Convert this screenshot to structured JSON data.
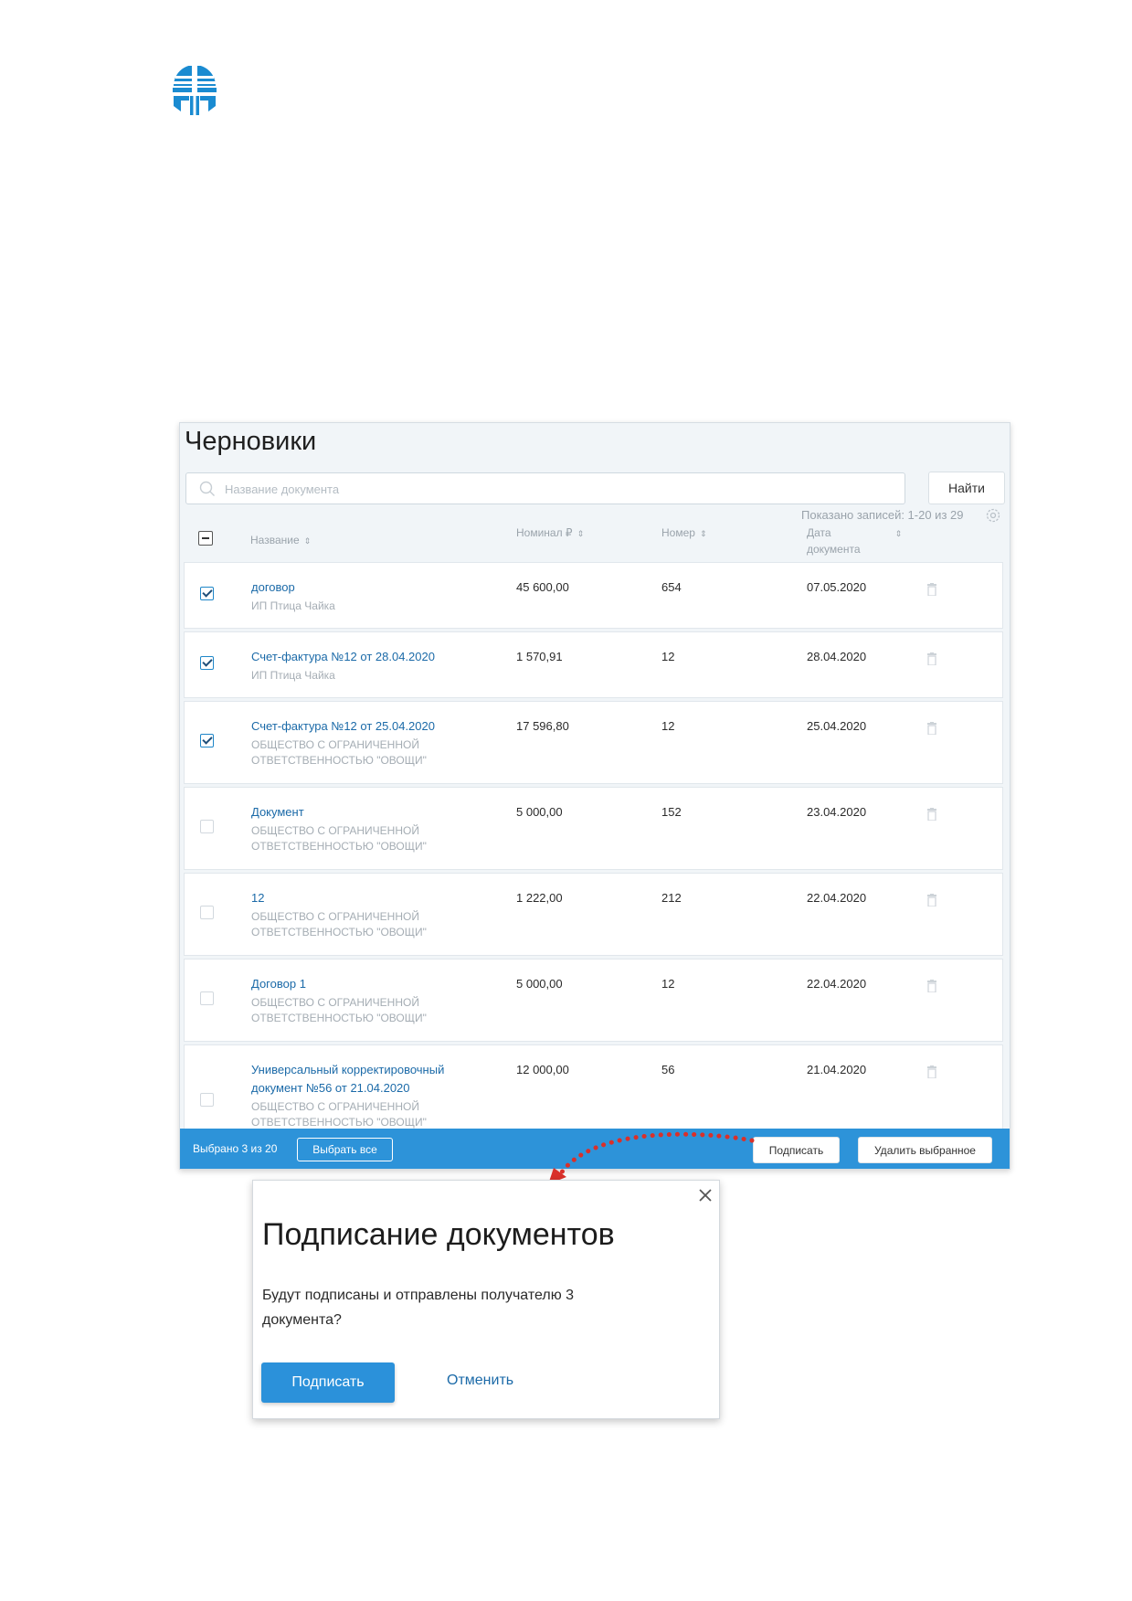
{
  "drafts": {
    "title": "Черновики",
    "search_placeholder": "Название документа",
    "find_button": "Найти",
    "records_info": "Показано записей: 1-20 из 29",
    "columns": {
      "name": "Название",
      "nominal": "Номинал ₽",
      "number": "Номер",
      "date_line1": "Дата",
      "date_line2": "документа"
    },
    "rows": [
      {
        "checked": true,
        "name": "договор",
        "org": "ИП Птица Чайка",
        "nominal": "45 600,00",
        "number": "654",
        "date": "07.05.2020"
      },
      {
        "checked": true,
        "name": "Счет-фактура №12 от 28.04.2020",
        "org": "ИП Птица Чайка",
        "nominal": "1 570,91",
        "number": "12",
        "date": "28.04.2020"
      },
      {
        "checked": true,
        "name": "Счет-фактура №12 от 25.04.2020",
        "org": "ОБЩЕСТВО С ОГРАНИЧЕННОЙ ОТВЕТСТВЕННОСТЬЮ \"ОВОЩИ\"",
        "nominal": "17 596,80",
        "number": "12",
        "date": "25.04.2020"
      },
      {
        "checked": false,
        "name": "Документ",
        "org": "ОБЩЕСТВО С ОГРАНИЧЕННОЙ ОТВЕТСТВЕННОСТЬЮ \"ОВОЩИ\"",
        "nominal": "5 000,00",
        "number": "152",
        "date": "23.04.2020"
      },
      {
        "checked": false,
        "name": "12",
        "org": "ОБЩЕСТВО С ОГРАНИЧЕННОЙ ОТВЕТСТВЕННОСТЬЮ \"ОВОЩИ\"",
        "nominal": "1 222,00",
        "number": "212",
        "date": "22.04.2020"
      },
      {
        "checked": false,
        "name": "Договор 1",
        "org": "ОБЩЕСТВО С ОГРАНИЧЕННОЙ ОТВЕТСТВЕННОСТЬЮ \"ОВОЩИ\"",
        "nominal": "5 000,00",
        "number": "12",
        "date": "22.04.2020"
      },
      {
        "checked": false,
        "name": "Универсальный корректировочный документ №56 от 21.04.2020",
        "org": "ОБЩЕСТВО С ОГРАНИЧЕННОЙ ОТВЕТСТВЕННОСТЬЮ \"ОВОЩИ\"",
        "nominal": "12 000,00",
        "number": "56",
        "date": "21.04.2020"
      }
    ],
    "bottom_bar": {
      "selected_count": "Выбрано 3 из 20",
      "select_all": "Выбрать все",
      "sign": "Подписать",
      "delete_selected": "Удалить выбранное"
    }
  },
  "dialog": {
    "title": "Подписание документов",
    "message": "Будут подписаны и отправлены получателю 3 документа?",
    "sign_button": "Подписать",
    "cancel_link": "Отменить"
  },
  "colors": {
    "accent": "#2d93d9",
    "link": "#1b6aa8",
    "logo": "#1a8bd1",
    "arrow": "#d9302a"
  },
  "icons": [
    "logo-icon",
    "search-icon",
    "settings-icon",
    "trash-icon",
    "close-icon",
    "arrow-icon"
  ]
}
